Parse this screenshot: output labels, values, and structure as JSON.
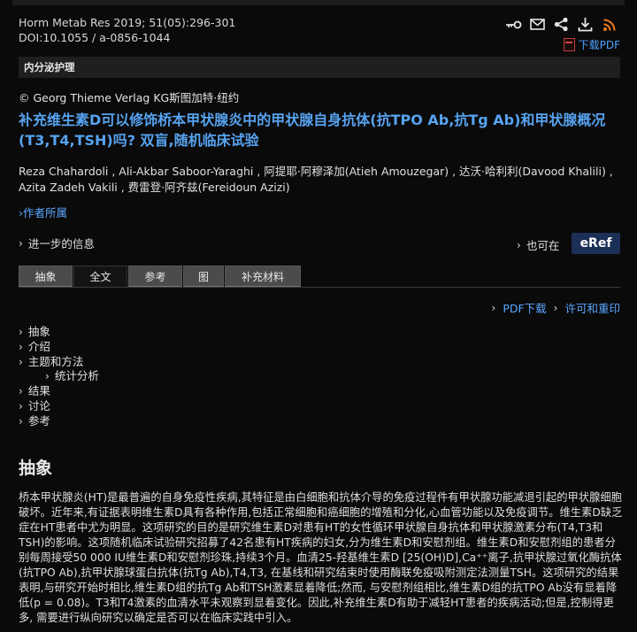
{
  "citation": {
    "line1": "Horm Metab Res 2019; 51(05):296-301",
    "line2": "DOI:10.1055 / a-0856-1044"
  },
  "tools": {
    "icons": [
      "key-link-icon",
      "email-icon",
      "share-icon",
      "download-icon",
      "rss-icon"
    ],
    "pdf_download_label": "下载PDF"
  },
  "category": "内分泌护理",
  "publisher": "© Georg Thieme Verlag KG斯图加特·纽约",
  "title": "补充维生素D可以修饰桥本甲状腺炎中的甲状腺自身抗体(抗TPO Ab,抗Tg Ab)和甲状腺概况(T3,T4,TSH)吗? 双盲,随机临床试验",
  "authors": "Reza Chahardoli , Ali-Akbar Saboor-Yaraghi , 阿提耶·阿穆泽加(Atieh Amouzegar) , 达沃·哈利利(Davood Khalili) , Azita Zadeh Vakili , 费雷登·阿齐兹(Fereidoun Azizi)",
  "affiliations_link": "›作者所属",
  "more_info": "进一步的信息",
  "also_available": "也可在",
  "eref": "eRef",
  "tabs": [
    {
      "label": "抽象",
      "width": 61
    },
    {
      "label": "全文",
      "width": 61
    },
    {
      "label": "参考",
      "width": 61
    },
    {
      "label": "图",
      "width": 46
    },
    {
      "label": "补充材料",
      "width": 86
    }
  ],
  "pdf_link": "PDF下载",
  "rights_link": "许可和重印",
  "toc": {
    "items": [
      "抽象",
      "介绍",
      "主题和方法",
      "结果",
      "讨论",
      "参考"
    ],
    "sub_item": "统计分析"
  },
  "abstract_heading": "抽象",
  "abstract_text": "桥本甲状腺炎(HT)是最普遍的自身免疫性疾病,其特征是由白细胞和抗体介导的免疫过程件有甲状腺功能减退引起的甲状腺细胞破坏。近年来,有证据表明维生素D具有各种作用,包括正常细胞和癌细胞的增殖和分化,心血管功能以及免疫调节。维生素D缺乏症在HT患者中尤为明显。这项研究的目的是研究维生素D对患有HT的女性循环甲状腺自身抗体和甲状腺激素分布(T4,T3和TSH)的影响。这项随机临床试验研究招募了42名患有HT疾病的妇女,分为维生素D和安慰剂组。维生素D和安慰剂组的患者分别每周接受50 000 IU维生素D和安慰剂珍珠,持续3个月。血清25-羟基维生素D [25(OH)D],Ca⁺⁺离子,抗甲状腺过氧化酶抗体(抗TPO Ab),抗甲状腺球蛋白抗体(抗Tg Ab),T4,T3, 在基线和研究结束时使用酶联免疫吸附测定法测量TSH。这项研究的结果表明,与研究开始时相比,维生素D组的抗Tg Ab和TSH激素显着降低;然而, 与安慰剂组相比,维生素D组的抗TPO Ab没有显着降低(p = 0.08)。T3和T4激素的血清水平未观察到显着变化。因此,补充维生素D有助于减轻HT患者的疾病活动;但是,控制得更多, 需要进行纵向研究以确定是否可以在临床实践中引入。"
}
